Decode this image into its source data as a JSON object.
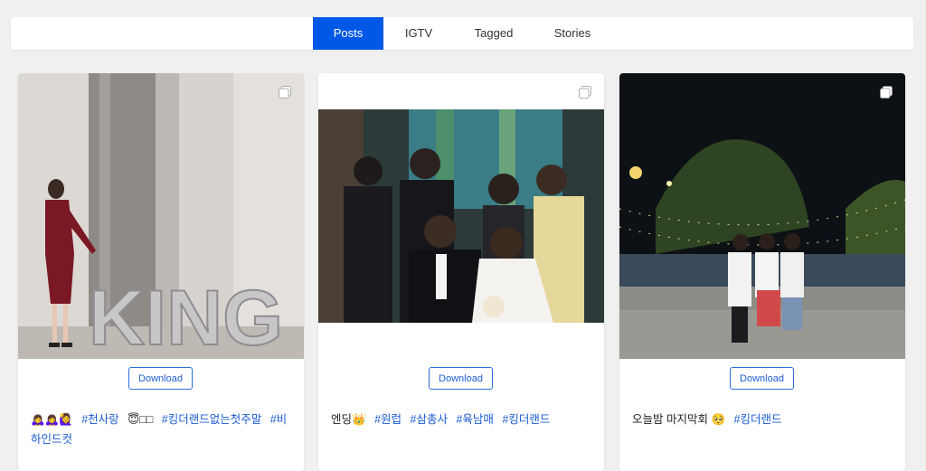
{
  "tabs": [
    {
      "label": "Posts",
      "active": true
    },
    {
      "label": "IGTV",
      "active": false
    },
    {
      "label": "Tagged",
      "active": false
    },
    {
      "label": "Stories",
      "active": false
    }
  ],
  "accent_color": "#0058e6",
  "posts": [
    {
      "media_icon": "multi-photo-icon",
      "photo_text": "KING",
      "download_label": "Download",
      "caption_text": "🙇‍♀️🙇‍♀️🙋‍♀️",
      "tags": [
        "#천사랑",
        "😇□□",
        "#킹더랜드없는첫주말",
        "#비하인드컷"
      ]
    },
    {
      "media_icon": "multi-photo-icon",
      "download_label": "Download",
      "caption_text": "엔딩👑",
      "tags": [
        "#원럽",
        "#삼총사",
        "#육남매",
        "#킹더랜드"
      ]
    },
    {
      "media_icon": "multi-photo-icon",
      "download_label": "Download",
      "caption_text": "오늘밤 마지막회 🥺",
      "tags": [
        "#킹더랜드"
      ]
    }
  ]
}
